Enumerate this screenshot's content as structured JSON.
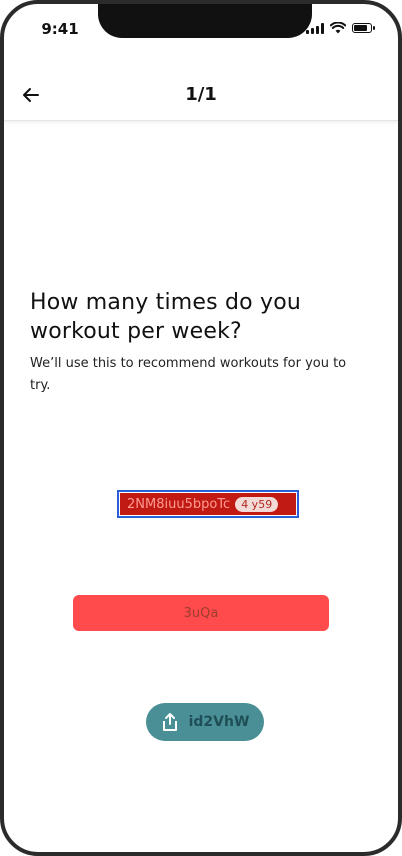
{
  "status_bar": {
    "time": "9:41"
  },
  "header": {
    "title": "1/1"
  },
  "question": {
    "title": "How many times do you workout per week?",
    "subtitle": "We’ll use this to recommend workouts for you to try."
  },
  "chip": {
    "label": "2NM8iuu5bpoTc",
    "badge": "4 y59"
  },
  "primary_button": {
    "label": "3uQa"
  },
  "share_button": {
    "label": "id2VhW"
  },
  "icons": {
    "back": "arrow-left-icon",
    "share": "share-icon"
  },
  "colors": {
    "chip_bg": "#c11a12",
    "chip_border": "#2b5fd6",
    "primary_button": "#ff4b4b",
    "share_button": "#4a8f96"
  }
}
